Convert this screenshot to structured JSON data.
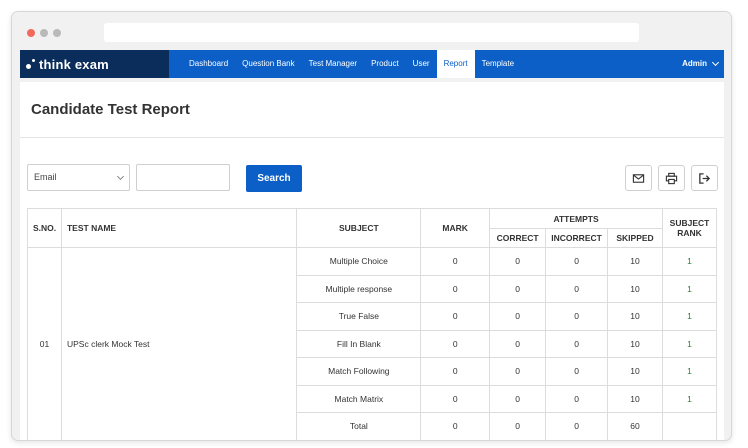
{
  "nav": {
    "brand": "think exam",
    "items": [
      "Dashboard",
      "Question Bank",
      "Test Manager",
      "Product",
      "User",
      "Report",
      "Template"
    ],
    "active_index": 5,
    "admin_label": "Admin"
  },
  "page": {
    "title": "Candidate Test Report"
  },
  "filters": {
    "select_value": "Email",
    "input_value": "",
    "search_label": "Search"
  },
  "table": {
    "headers": {
      "sno": "S.NO.",
      "test_name": "TEST NAME",
      "subject": "SUBJECT",
      "mark": "MARK",
      "attempts": "ATTEMPTS",
      "correct": "CORRECT",
      "incorrect": "INCORRECT",
      "skipped": "SKIPPED",
      "rank_line1": "SUBJECT",
      "rank_line2": "RANK"
    },
    "sno": "01",
    "test_name": "UPSc clerk Mock Test",
    "rows": [
      {
        "subject": "Multiple Choice",
        "mark": "0",
        "correct": "0",
        "incorrect": "0",
        "skipped": "10",
        "rank": "1"
      },
      {
        "subject": "Multiple response",
        "mark": "0",
        "correct": "0",
        "incorrect": "0",
        "skipped": "10",
        "rank": "1"
      },
      {
        "subject": "True False",
        "mark": "0",
        "correct": "0",
        "incorrect": "0",
        "skipped": "10",
        "rank": "1"
      },
      {
        "subject": "Fill In Blank",
        "mark": "0",
        "correct": "0",
        "incorrect": "0",
        "skipped": "10",
        "rank": "1"
      },
      {
        "subject": "Match Following",
        "mark": "0",
        "correct": "0",
        "incorrect": "0",
        "skipped": "10",
        "rank": "1"
      },
      {
        "subject": "Match Matrix",
        "mark": "0",
        "correct": "0",
        "incorrect": "0",
        "skipped": "10",
        "rank": "1"
      },
      {
        "subject": "Total",
        "mark": "0",
        "correct": "0",
        "incorrect": "0",
        "skipped": "60",
        "rank": ""
      }
    ]
  }
}
